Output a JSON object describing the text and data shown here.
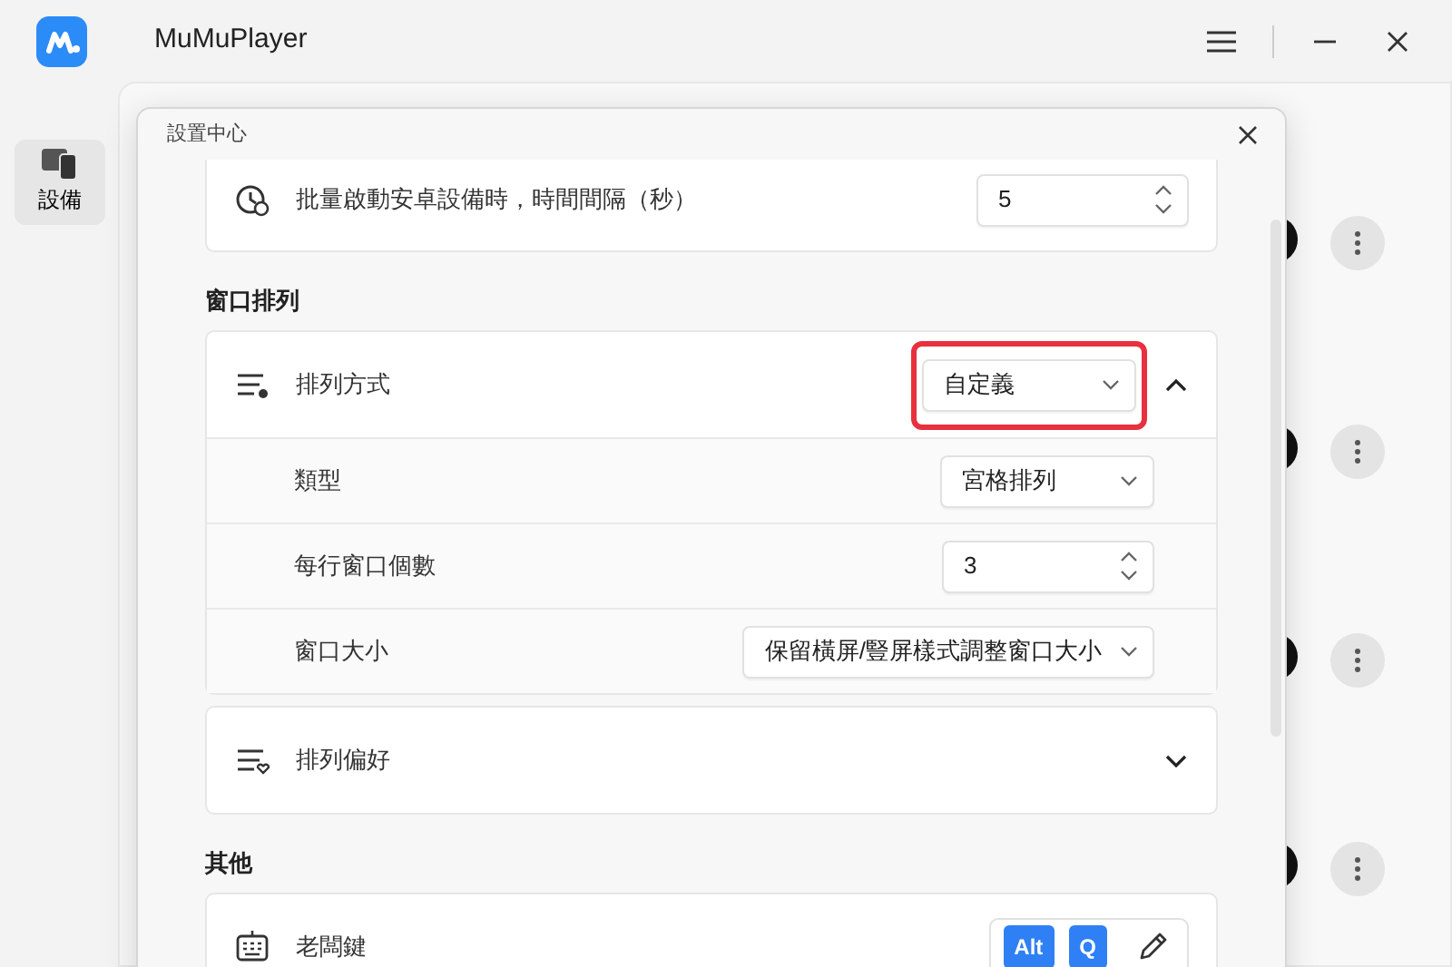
{
  "app": {
    "title": "MuMuPlayer"
  },
  "sidebar": {
    "items": [
      {
        "label": "設備",
        "selected": true
      }
    ]
  },
  "background_rows": [
    {
      "kind": "device"
    },
    {
      "kind": "device"
    },
    {
      "kind": "device"
    },
    {
      "kind": "device"
    }
  ],
  "dialog": {
    "title": "設置中心",
    "sections": [
      {
        "cards": [
          {
            "kind": "timer",
            "label": "批量啟動安卓設備時，時間間隔（秒）",
            "control": {
              "kind": "spinner",
              "value": "5"
            }
          }
        ]
      },
      {
        "heading": "窗口排列",
        "cards": [
          {
            "kind": "layout",
            "label": "排列方式",
            "highlighted": true,
            "expanded": true,
            "control": {
              "kind": "select",
              "value": "自定義"
            },
            "children": [
              {
                "label": "類型",
                "control": {
                  "kind": "select",
                  "value": "宮格排列"
                }
              },
              {
                "label": "每行窗口個數",
                "control": {
                  "kind": "spinner",
                  "value": "3"
                }
              },
              {
                "label": "窗口大小",
                "control": {
                  "kind": "select",
                  "value": "保留橫屏/豎屏樣式調整窗口大小"
                }
              }
            ]
          },
          {
            "kind": "preference",
            "label": "排列偏好",
            "expanded": false
          }
        ]
      },
      {
        "heading": "其他",
        "cards": [
          {
            "kind": "hotkey",
            "label": "老闆鍵",
            "control": {
              "kind": "keys",
              "keys": [
                "Alt",
                "Q"
              ]
            }
          }
        ]
      }
    ]
  }
}
